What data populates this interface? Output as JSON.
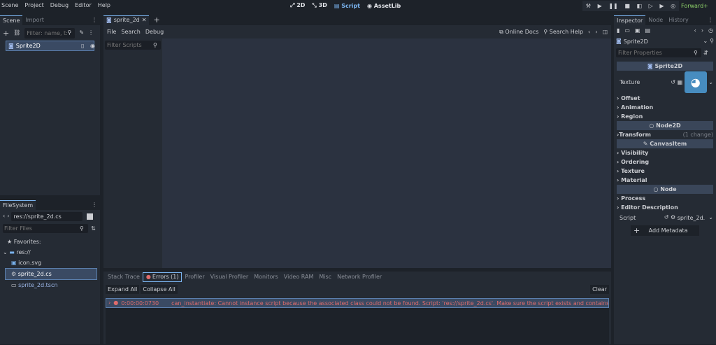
{
  "menu": {
    "scene": "Scene",
    "project": "Project",
    "debug": "Debug",
    "editor": "Editor",
    "help": "Help"
  },
  "workspaces": {
    "w2d": "2D",
    "w3d": "3D",
    "script": "Script",
    "assetlib": "AssetLib"
  },
  "renderer": "Forward+",
  "scene_dock": {
    "tab_scene": "Scene",
    "tab_import": "Import",
    "filter_placeholder": "Filter: name, t:t",
    "node_name": "Sprite2D"
  },
  "filesystem": {
    "tab": "FileSystem",
    "path": "res://sprite_2d.cs",
    "filter_placeholder": "Filter Files",
    "favorites": "Favorites:",
    "root": "res://",
    "files": {
      "f0": "icon.svg",
      "f1": "sprite_2d.cs",
      "f2": "sprite_2d.tscn"
    }
  },
  "script_editor": {
    "tab": "sprite_2d",
    "menu_file": "File",
    "menu_search": "Search",
    "menu_debug": "Debug",
    "online_docs": "Online Docs",
    "search_help": "Search Help",
    "filter_scripts": "Filter Scripts"
  },
  "bottom": {
    "tabs": {
      "t0": "Stack Trace",
      "t1": "Errors (1)",
      "t2": "Profiler",
      "t3": "Visual Profiler",
      "t4": "Monitors",
      "t5": "Video RAM",
      "t6": "Misc",
      "t7": "Network Profiler"
    },
    "expand_all": "Expand All",
    "collapse_all": "Collapse All",
    "clear": "Clear",
    "error_time": "0:00:00:0730",
    "error_msg": "can_instantiate: Cannot instance script because the associated class could not be found. Script: 'res://sprite_2d.cs'. Make sure the script exists and contains a class definition with ..."
  },
  "inspector": {
    "tab_inspector": "Inspector",
    "tab_node": "Node",
    "tab_history": "History",
    "object": "Sprite2D",
    "filter_placeholder": "Filter Properties",
    "section_sprite2d": "Sprite2D",
    "texture_label": "Texture",
    "offset": "Offset",
    "animation": "Animation",
    "region": "Region",
    "section_node2d": "Node2D",
    "transform": "Transform",
    "transform_note": "(1 change)",
    "section_canvasitem": "CanvasItem",
    "visibility": "Visibility",
    "ordering": "Ordering",
    "texture": "Texture",
    "material": "Material",
    "section_node": "Node",
    "process": "Process",
    "editor_description": "Editor Description",
    "script_label": "Script",
    "script_value": "sprite_2d.",
    "add_metadata": "Add Metadata"
  },
  "colors": {
    "accent": "#7ab3ee",
    "error": "#e06c6c",
    "renderer": "#8fd36a",
    "tool_icon": "#e06666"
  }
}
